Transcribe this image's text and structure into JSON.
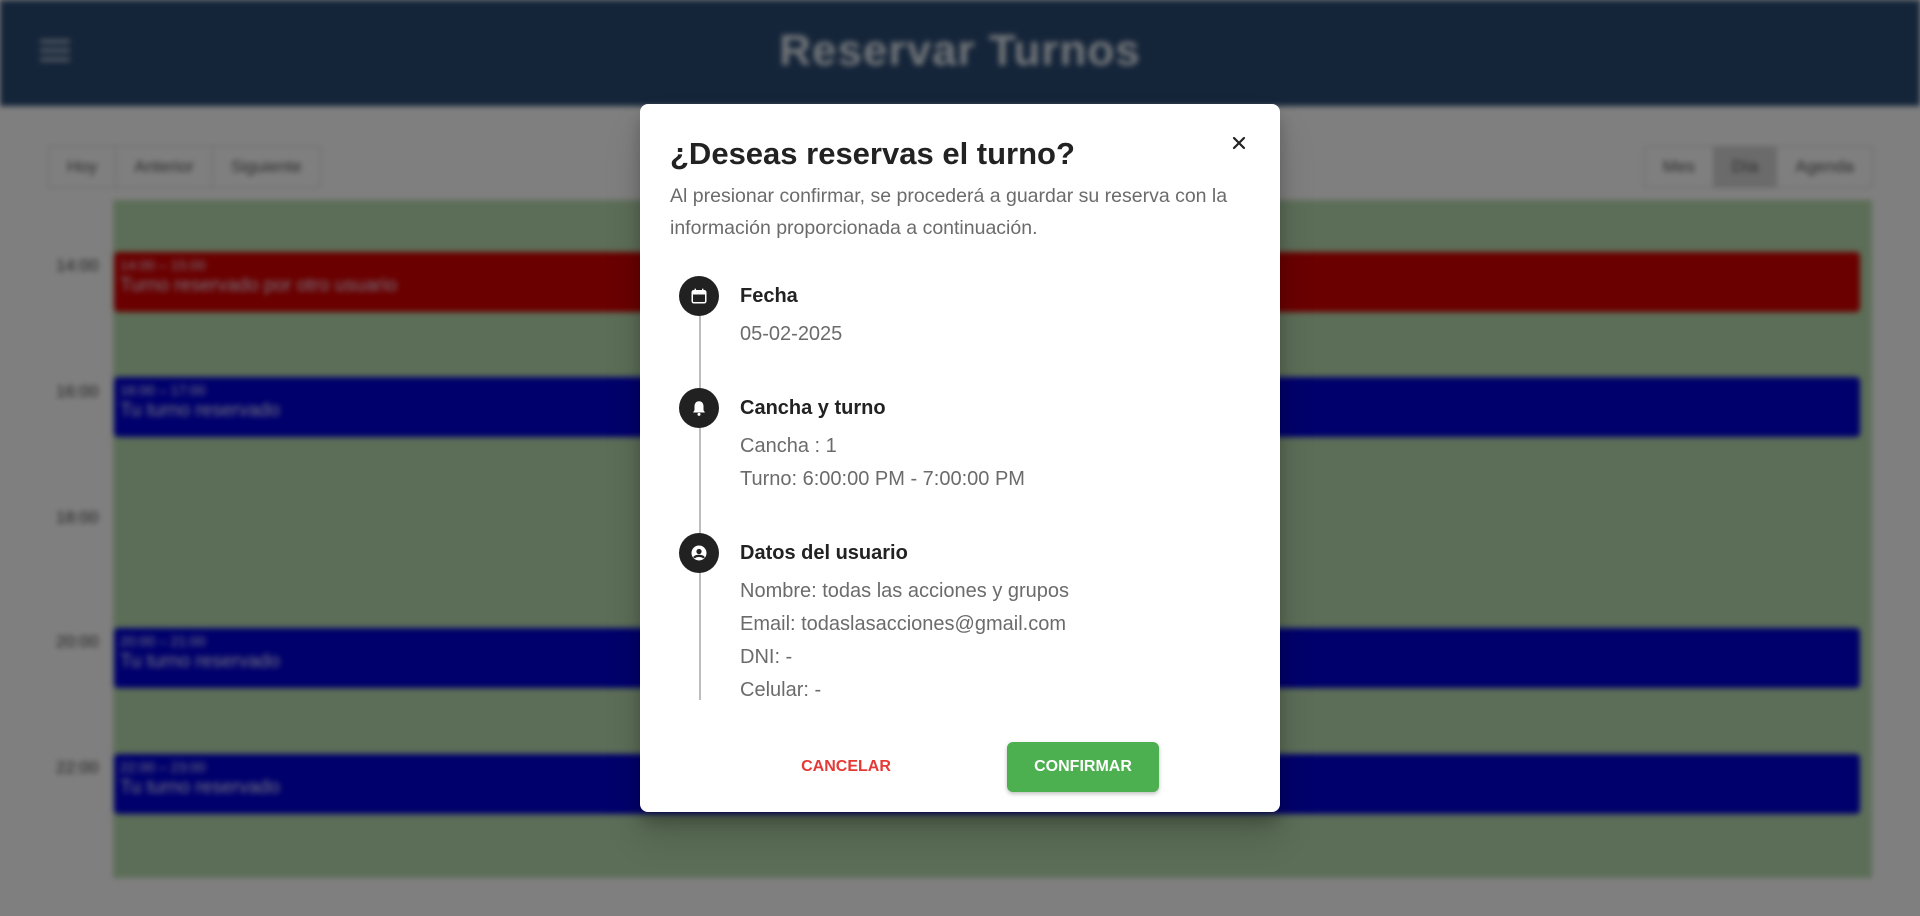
{
  "app": {
    "title": "Reservar Turnos",
    "nav_left": [
      "Hoy",
      "Anterior",
      "Siguiente"
    ],
    "nav_right": [
      "Mes",
      "Día",
      "Agenda"
    ],
    "hours": [
      "14:00",
      "16:00",
      "18:00",
      "20:00",
      "22:00"
    ],
    "events": [
      {
        "time": "14:00 – 15:00",
        "title": "Turno reservado por otro usuario",
        "color": "#d40000"
      },
      {
        "time": "16:00 – 17:00",
        "title": "Tu turno reservado",
        "color": "#0000d8"
      },
      {
        "time": "20:00 – 21:00",
        "title": "Tu turno reservado",
        "color": "#0000d8"
      },
      {
        "time": "22:00 – 23:00",
        "title": "Tu turno reservado",
        "color": "#0000d8"
      }
    ]
  },
  "modal": {
    "title": "¿Deseas reservas el turno?",
    "description": "Al presionar confirmar, se procederá a guardar su reserva con la información proporcionada a continuación.",
    "sections": [
      {
        "icon": "calendar-icon",
        "heading": "Fecha",
        "lines": [
          "05-02-2025"
        ]
      },
      {
        "icon": "bell-icon",
        "heading": "Cancha y turno",
        "lines": [
          "Cancha : 1",
          "Turno: 6:00:00 PM - 7:00:00 PM"
        ]
      },
      {
        "icon": "user-circle-icon",
        "heading": "Datos del usuario",
        "lines": [
          "Nombre: todas las acciones y grupos",
          "Email: todaslasacciones@gmail.com",
          "DNI: -",
          "Celular: -"
        ]
      }
    ],
    "cancel_label": "CANCELAR",
    "confirm_label": "CONFIRMAR"
  },
  "colors": {
    "header_bg": "#2a4a73",
    "calendar_bg": "#b9dcaf",
    "confirm_bg": "#4caf50",
    "cancel_text": "#e53935"
  }
}
